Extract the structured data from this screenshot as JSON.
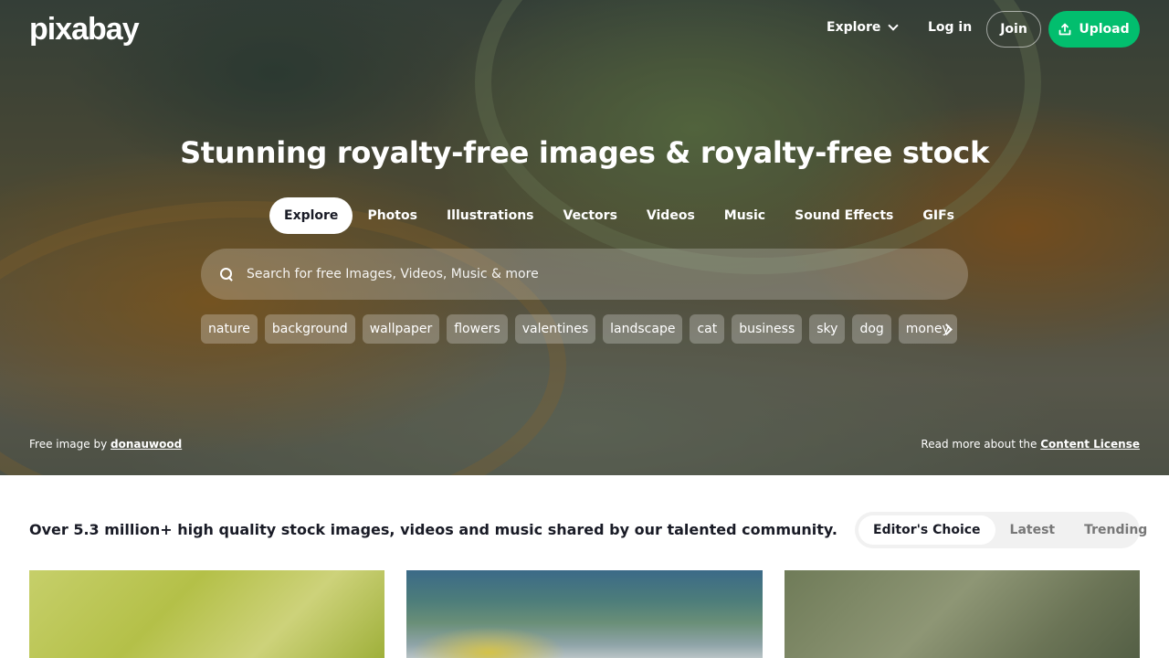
{
  "header": {
    "logo": "pixabay",
    "explore_label": "Explore",
    "login_label": "Log in",
    "join_label": "Join",
    "upload_label": "Upload",
    "upload_color": "#02be6e"
  },
  "hero": {
    "title": "Stunning royalty-free images & royalty-free stock",
    "tabs": [
      "Explore",
      "Photos",
      "Illustrations",
      "Vectors",
      "Videos",
      "Music",
      "Sound Effects",
      "GIFs"
    ],
    "active_tab": "Explore",
    "search": {
      "placeholder": "Search for free Images, Videos, Music & more"
    },
    "chips": [
      "nature",
      "background",
      "wallpaper",
      "flowers",
      "valentines",
      "landscape",
      "cat",
      "business",
      "sky",
      "dog",
      "money"
    ],
    "credit_prefix": "Free image by",
    "credit_author": "donauwood",
    "license_prefix": "Read more about the",
    "license_link": "Content License"
  },
  "content": {
    "tagline": "Over 5.3 million+ high quality stock images, videos and music shared by our talented community.",
    "sort_options": [
      "Editor's Choice",
      "Latest",
      "Trending"
    ],
    "active_sort": "Editor's Choice"
  }
}
